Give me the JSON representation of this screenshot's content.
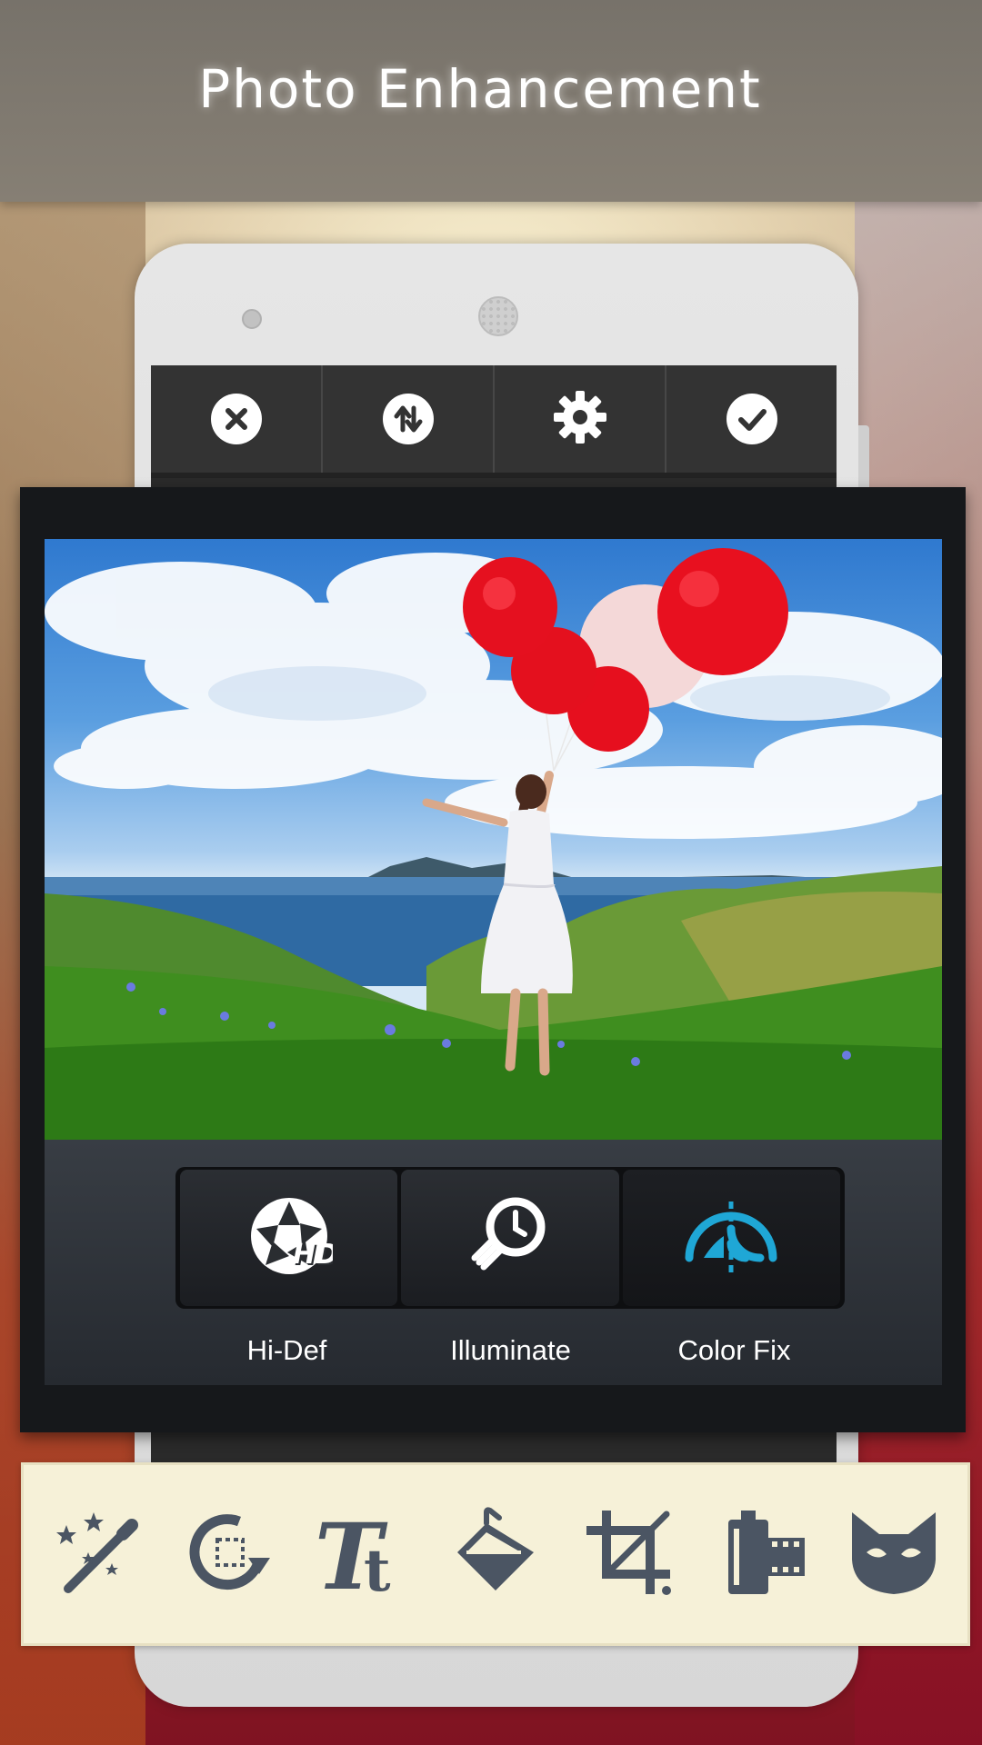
{
  "header": {
    "title": "Photo Enhancement"
  },
  "phone_toolbar": {
    "items": [
      {
        "icon": "close-icon"
      },
      {
        "icon": "swap-icon"
      },
      {
        "icon": "gear-icon"
      },
      {
        "icon": "check-icon"
      }
    ]
  },
  "photo": {
    "subject": "woman-with-red-balloons"
  },
  "enhance_panel": {
    "buttons": [
      {
        "label": "Hi-Def",
        "icon": "hd-aperture-icon",
        "active": false
      },
      {
        "label": "Illuminate",
        "icon": "lightbulb-icon",
        "active": false
      },
      {
        "label": "Color Fix",
        "icon": "color-fix-icon",
        "active": true
      }
    ]
  },
  "tool_strip": {
    "tools": [
      {
        "icon": "magic-wand-icon"
      },
      {
        "icon": "rotate-icon"
      },
      {
        "icon": "text-icon"
      },
      {
        "icon": "paint-bucket-icon"
      },
      {
        "icon": "crop-icon"
      },
      {
        "icon": "film-icon"
      },
      {
        "icon": "cat-mask-icon"
      }
    ]
  },
  "colors": {
    "accent": "#1fa7d6",
    "header_bg": "#7d776e",
    "strip_bg": "#f6f1d8",
    "tool_icon": "#4b5563"
  }
}
